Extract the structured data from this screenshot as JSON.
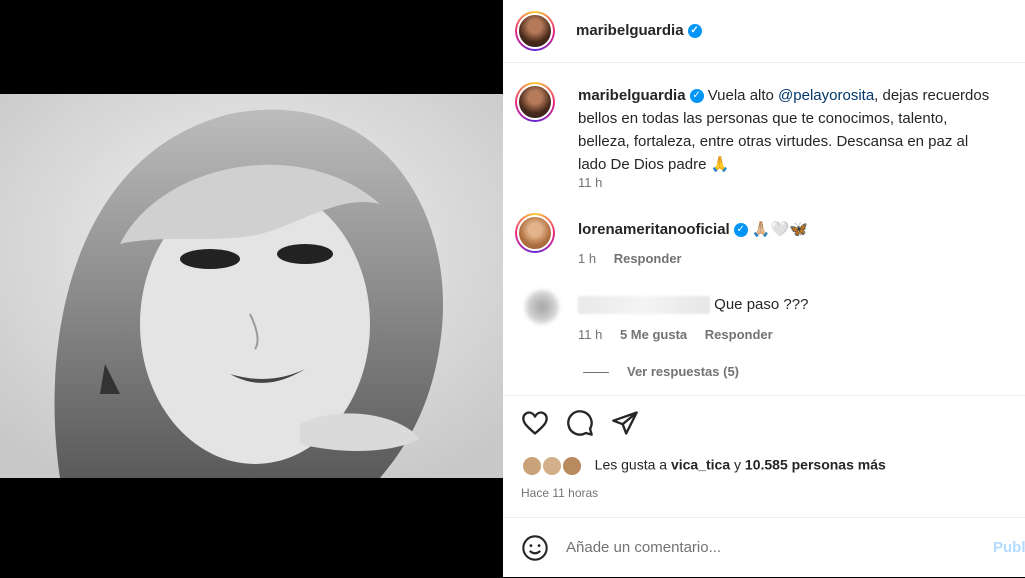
{
  "header": {
    "username": "maribelguardia"
  },
  "post": {
    "caption_user": "maribelguardia",
    "caption_prefix": "Vuela alto ",
    "caption_mention": "@pelayorosita",
    "caption_suffix": ", dejas recuerdos bellos en todas las personas que te conocimos, talento, belleza, fortaleza, entre otras virtudes. Descansa en paz al lado De Dios padre 🙏",
    "caption_time": "11 h"
  },
  "comments": [
    {
      "user": "lorenameritanooficial",
      "text": "🙏🏼🤍🦋",
      "time": "1 h",
      "reply": "Responder"
    },
    {
      "user": "",
      "text": "Que paso ???",
      "time": "11 h",
      "likes": "5 Me gusta",
      "reply": "Responder"
    }
  ],
  "replies_link": "Ver respuestas (5)",
  "likes": {
    "prefix": "Les gusta a ",
    "user": "vica_tica",
    "middle": " y ",
    "count": "10.585 personas más"
  },
  "post_time": "Hace 11 horas",
  "add_comment": {
    "placeholder": "Añade un comentario...",
    "publish": "Publicar"
  },
  "icons": [
    "heart-icon",
    "comment-icon",
    "share-icon",
    "emoji-icon",
    "verified-icon"
  ]
}
